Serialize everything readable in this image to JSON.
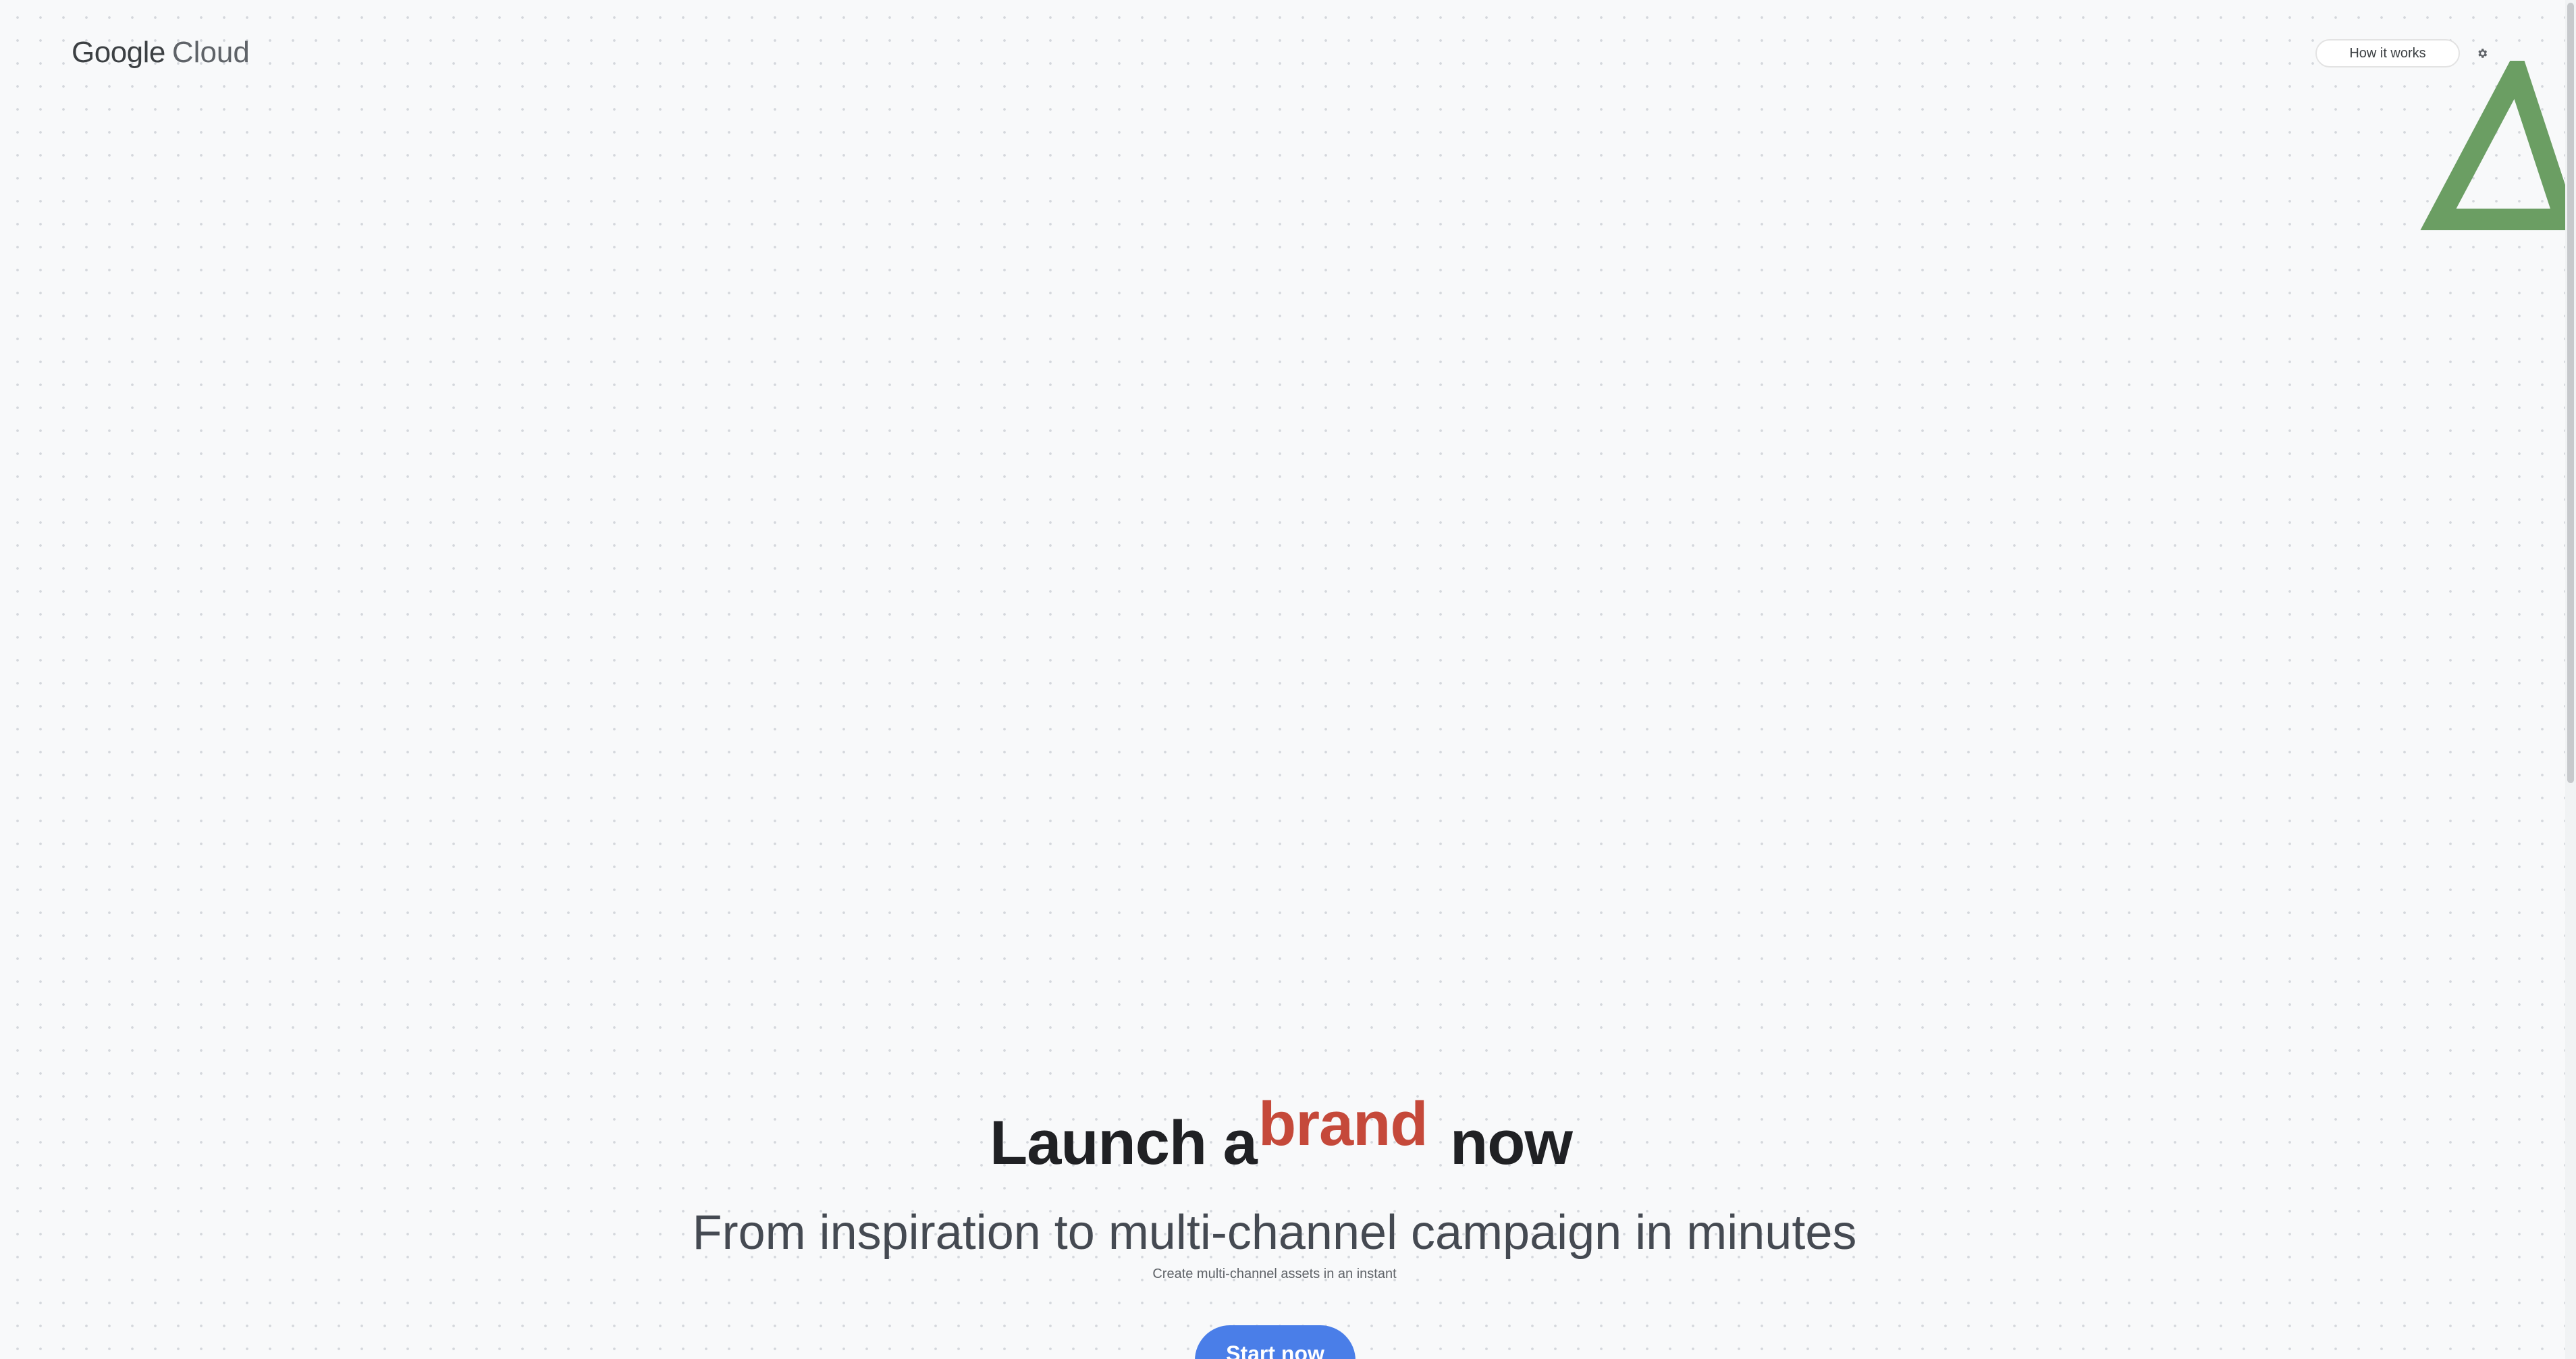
{
  "header": {
    "logo_brand": "Google",
    "logo_product": "Cloud",
    "how_it_works_label": "How it works",
    "settings_icon": "gear-icon"
  },
  "decor": {
    "shape_icon": "triangle-outline-icon",
    "shape_color": "#6b9e63"
  },
  "hero": {
    "headline_prefix": "Launch a",
    "headline_highlight": "brand",
    "headline_suffix": "now",
    "subheadline": "From inspiration to multi-channel campaign in minutes",
    "tagline": "Create multi-channel assets in an instant",
    "cta_label": "Start now"
  },
  "colors": {
    "highlight": "#c5493a",
    "primary_button": "#4a7ee8",
    "background": "#f8f9fa"
  }
}
